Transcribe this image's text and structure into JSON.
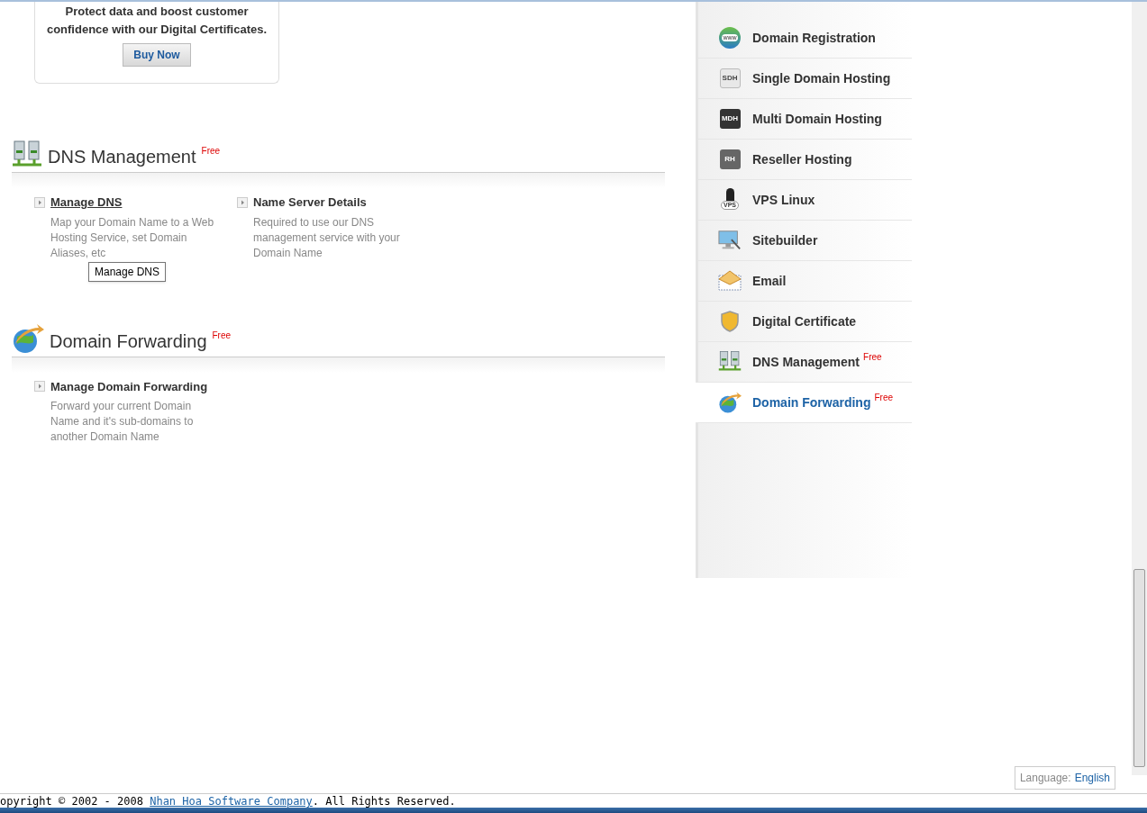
{
  "promo": {
    "text": "Protect data and boost customer confidence with our Digital Certificates.",
    "button": "Buy Now"
  },
  "sections": [
    {
      "kind": "servers",
      "title": "DNS Management",
      "tag": "Free",
      "links": [
        {
          "label": "Manage DNS",
          "hovered": true,
          "tooltip": "Manage DNS",
          "description": "Map your Domain Name to a Web Hosting Service, set Domain Aliases, etc"
        },
        {
          "label": "Name Server Details",
          "hovered": false,
          "description": "Required to use our DNS management service with your Domain Name"
        }
      ]
    },
    {
      "kind": "globe",
      "title": "Domain Forwarding",
      "tag": "Free",
      "links": [
        {
          "label": "Manage Domain Forwarding",
          "hovered": false,
          "description": "Forward your current Domain Name and it's sub-domains to another Domain Name"
        }
      ]
    }
  ],
  "sidebar": {
    "items": [
      {
        "kind": "globe",
        "badge": "www",
        "label": "Domain Registration",
        "selected": false
      },
      {
        "kind": "light",
        "badge": "SDH",
        "label": "Single Domain Hosting",
        "selected": false
      },
      {
        "kind": "dark",
        "badge": "MDH",
        "label": "Multi Domain Hosting",
        "selected": false
      },
      {
        "kind": "gray",
        "badge": "RH",
        "label": "Reseller Hosting",
        "selected": false
      },
      {
        "kind": "penguin",
        "badge": "VPS",
        "label": "VPS Linux",
        "selected": false
      },
      {
        "kind": "monitor",
        "label": "Sitebuilder",
        "selected": false
      },
      {
        "kind": "mail",
        "label": "Email",
        "selected": false
      },
      {
        "kind": "shield",
        "label": "Digital Certificate",
        "selected": false
      },
      {
        "kind": "servers",
        "label": "DNS Management",
        "tag": "Free",
        "selected": false
      },
      {
        "kind": "forward",
        "label": "Domain Forwarding",
        "tag": "Free",
        "selected": true
      }
    ]
  },
  "language": {
    "label": "Language:",
    "value": "English"
  },
  "footer": {
    "text": "opyright © 2002 - 2008",
    "link": "Nhan Hoa Software Company",
    "rest": ". All Rights Reserved."
  }
}
